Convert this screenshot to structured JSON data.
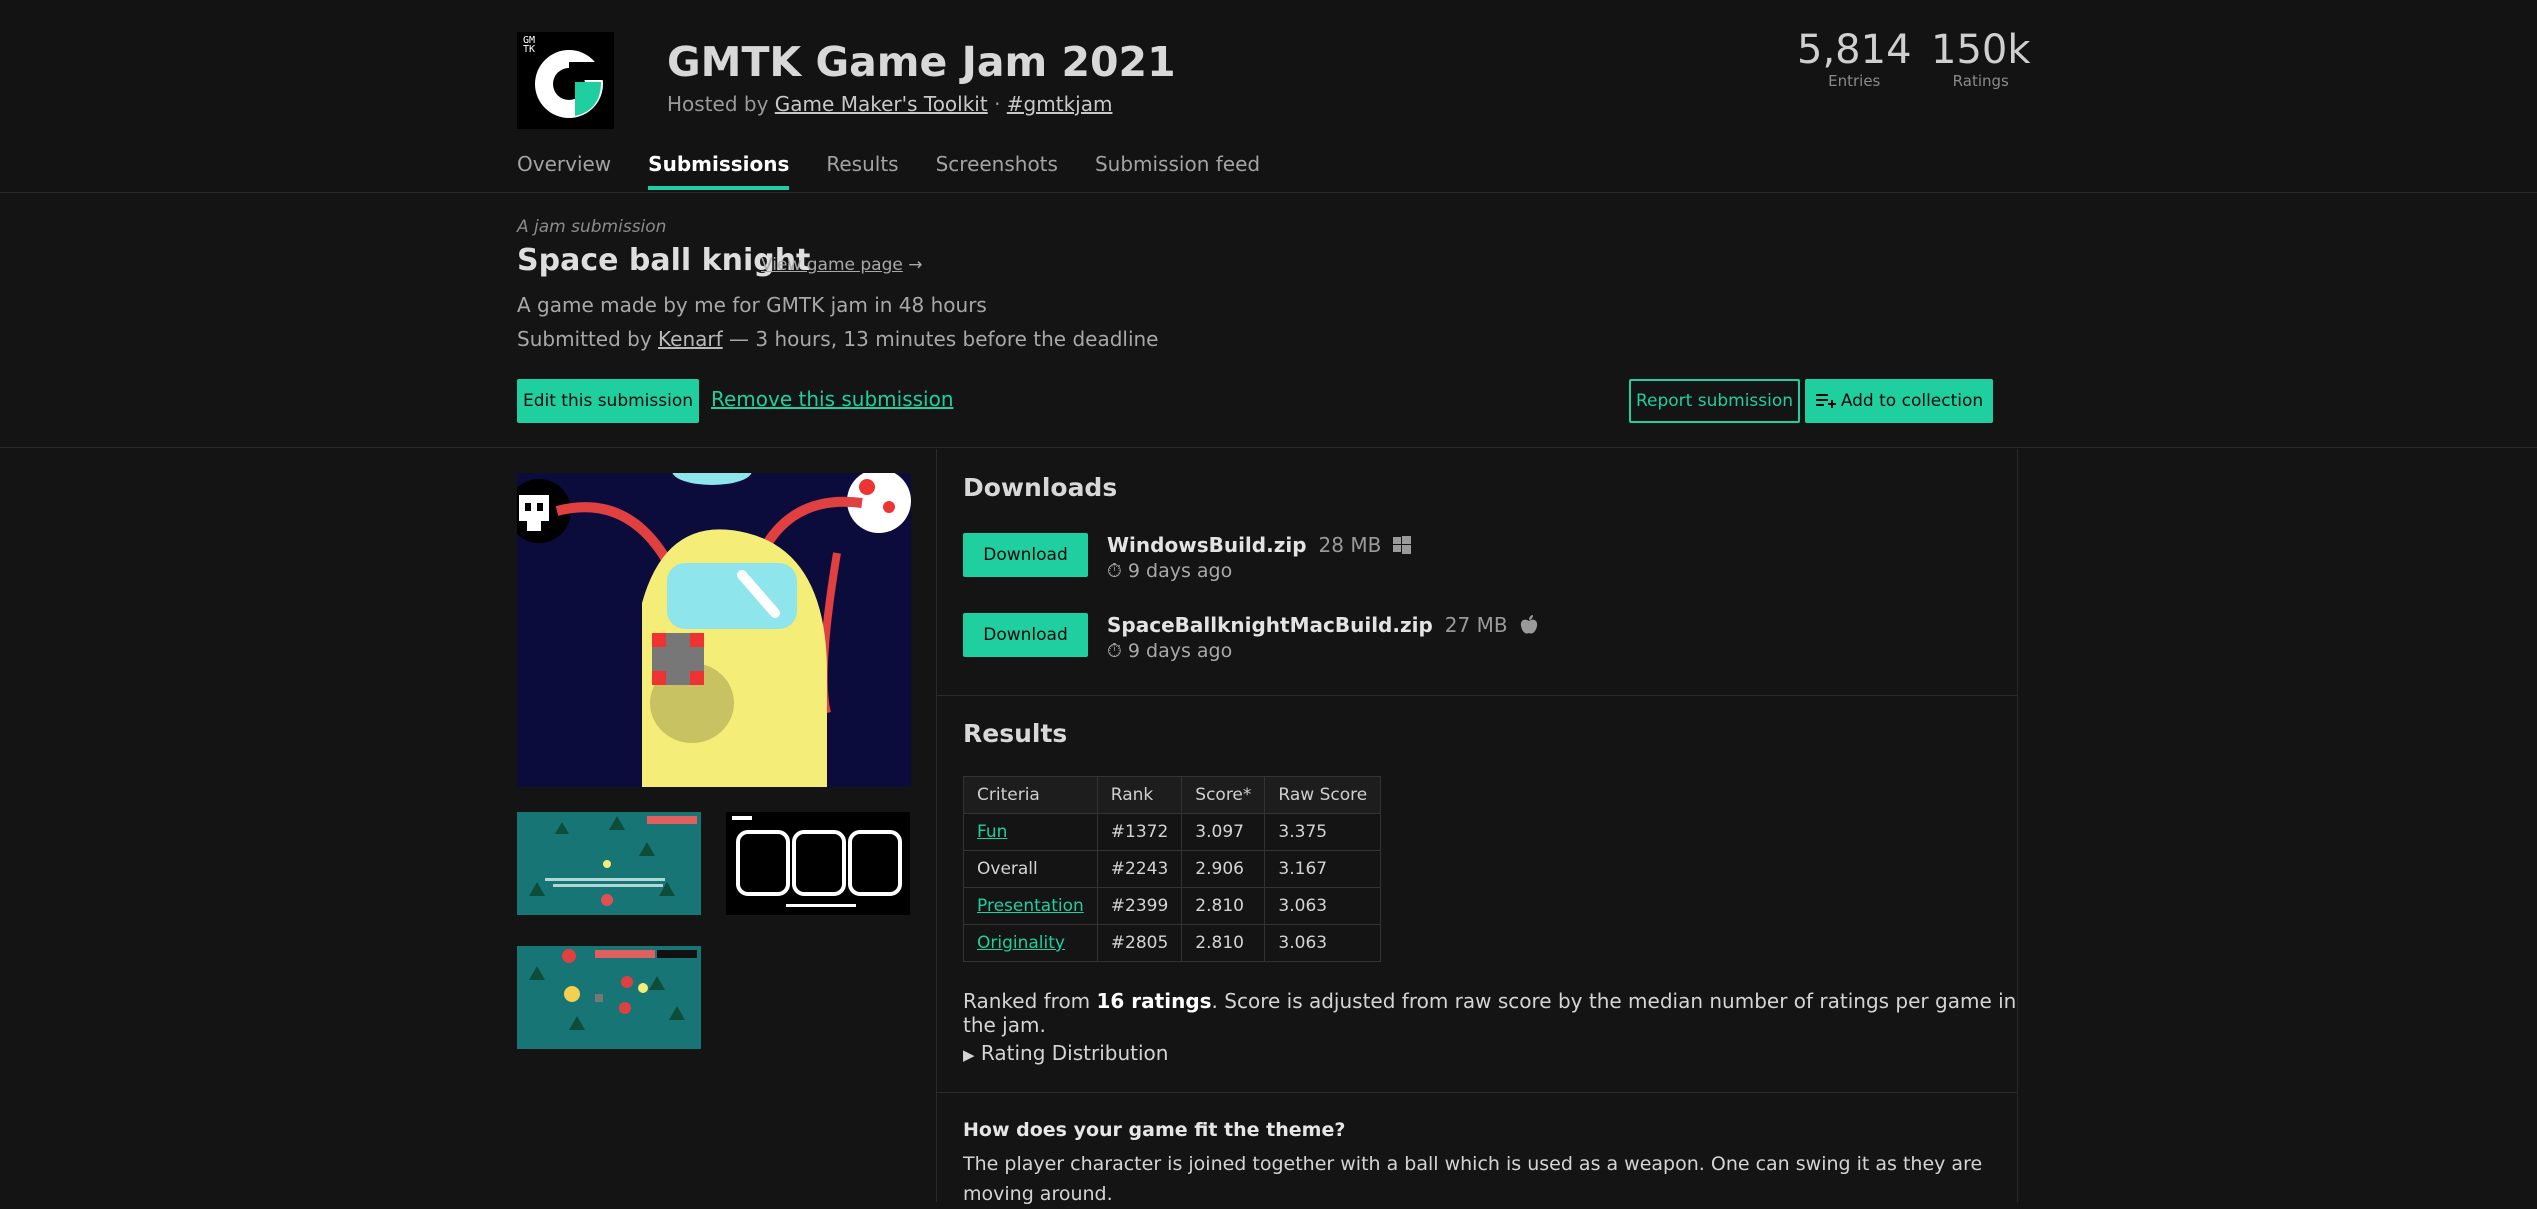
{
  "jam": {
    "logo_small_text": "GM\nTK",
    "title": "GMTK Game Jam 2021",
    "hosted_prefix": "Hosted by ",
    "host": "Game Maker's Toolkit",
    "sep": " · ",
    "hashtag": "#gmtkjam",
    "stats": [
      {
        "value": "5,814",
        "label": "Entries"
      },
      {
        "value": "150k",
        "label": "Ratings"
      }
    ]
  },
  "tabs": [
    "Overview",
    "Submissions",
    "Results",
    "Screenshots",
    "Submission feed"
  ],
  "active_tab": "Submissions",
  "submission": {
    "kicker": "A jam submission",
    "title": "Space ball knight",
    "view_page": "View game page",
    "view_arrow": "→",
    "description": "A game made by me for GMTK jam in 48 hours",
    "submitted_prefix": "Submitted by ",
    "author": "Kenarf",
    "submitted_suffix": " — 3 hours, 13 minutes before the deadline",
    "edit_label": "Edit this submission",
    "remove_label": "Remove this submission",
    "report_label": "Report submission",
    "collection_label": "Add to collection"
  },
  "downloads": {
    "title": "Downloads",
    "items": [
      {
        "button": "Download",
        "name": "WindowsBuild.zip",
        "size": "28 MB",
        "platform_icon": "windows-icon",
        "date": "9 days ago"
      },
      {
        "button": "Download",
        "name": "SpaceBallknightMacBuild.zip",
        "size": "27 MB",
        "platform_icon": "apple-icon",
        "date": "9 days ago"
      }
    ]
  },
  "results": {
    "title": "Results",
    "headers": [
      "Criteria",
      "Rank",
      "Score*",
      "Raw Score"
    ],
    "rows": [
      {
        "criteria": "Fun",
        "rank": "#1372",
        "score": "3.097",
        "raw": "3.375"
      },
      {
        "criteria": "Overall",
        "rank": "#2243",
        "score": "2.906",
        "raw": "3.167"
      },
      {
        "criteria": "Presentation",
        "rank": "#2399",
        "score": "2.810",
        "raw": "3.063"
      },
      {
        "criteria": "Originality",
        "rank": "#2805",
        "score": "2.810",
        "raw": "3.063"
      }
    ],
    "ranked_prefix": "Ranked from ",
    "ranked_count": "16 ratings",
    "ranked_suffix": ". Score is adjusted from raw score by the median number of ratings per game in the jam.",
    "distribution_label": "Rating Distribution"
  },
  "theme_q": {
    "question": "How does your game fit the theme?",
    "answer": "The player character is joined together with a ball which is used as a weapon. One can swing it as they are moving around."
  },
  "colors": {
    "accent": "#1fcf9f",
    "background": "#141414"
  }
}
